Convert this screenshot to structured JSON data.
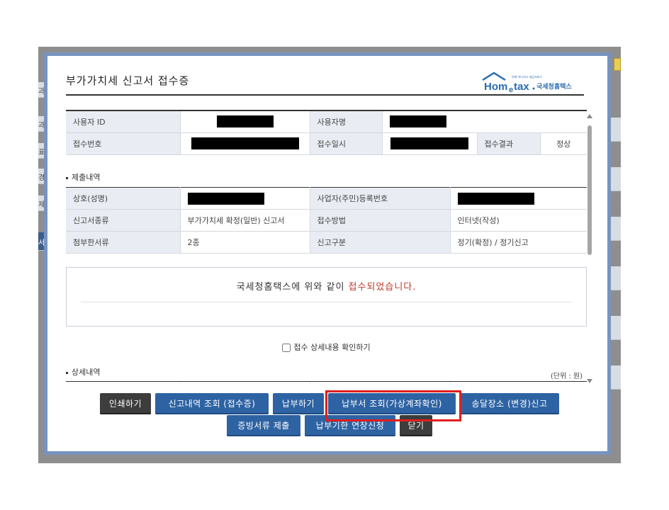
{
  "background": {
    "left_tabs": [
      "과",
      "과",
      "표",
      "경",
      "제",
      "서"
    ]
  },
  "modal": {
    "title": "부가가치세 신고서 접수증",
    "logo": {
      "small_text": "언제 어디서나 세금서비스",
      "brand": "Hometax",
      "brand_kr": "국세청홈택스"
    },
    "receipt_info": {
      "user_id_label": "사용자 ID",
      "user_name_label": "사용자명",
      "receipt_no_label": "접수번호",
      "receipt_datetime_label": "접수일시",
      "receipt_result_label": "접수결과",
      "receipt_result_value": "정상"
    },
    "submission": {
      "section_title": "제출내역",
      "company_label": "상호(성명)",
      "reg_no_label": "사업자(주민)등록번호",
      "report_type_label": "신고서종류",
      "report_type_value": "부가가치세 확정(일반) 신고서",
      "receipt_method_label": "접수방법",
      "receipt_method_value": "인터넷(작성)",
      "attached_label": "첨부한서류",
      "attached_value": "2종",
      "report_category_label": "신고구분",
      "report_category_value": "정기(확정) / 정기신고"
    },
    "notice": {
      "text_prefix": "국세청홈택스에 위와 같이 ",
      "text_highlight": "접수되었습니다."
    },
    "confirm_checkbox_label": "접수 상세내용 확인하기",
    "details": {
      "section_title": "상세내역",
      "unit": "(단위 : 원)"
    },
    "buttons": {
      "print": "인쇄하기",
      "report_lookup": "신고내역 조회 (접수증)",
      "pay": "납부하기",
      "payment_lookup": "납부서 조회(가상계좌확인)",
      "delivery_place": "송달장소 (변경)신고",
      "evidence_submit": "증빙서류 제출",
      "deadline_extension": "납부기한 연장신청",
      "close": "닫기"
    }
  },
  "colors": {
    "modal_border": "#7793c0",
    "button_blue": "#2e63a3",
    "button_dark": "#3d3d3d",
    "highlight_red": "#e01e1e",
    "notice_red": "#c0392b",
    "table_header_bg": "#e9edf3"
  }
}
